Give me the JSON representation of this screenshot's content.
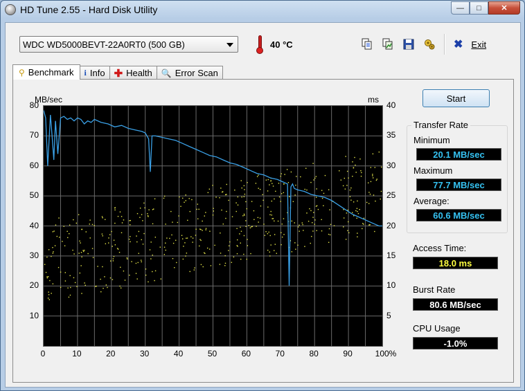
{
  "window": {
    "title": "HD Tune 2.55 - Hard Disk Utility"
  },
  "caption": {
    "minimize": "—",
    "maximize": "□",
    "close": "✕"
  },
  "drive": {
    "selected": "WDC WD5000BEVT-22A0RT0 (500 GB)"
  },
  "temperature": {
    "value": "40 °C"
  },
  "toolbar": {
    "exit_label": "Exit",
    "icons": [
      "copy-text-icon",
      "copy-image-icon",
      "save-icon",
      "options-icon",
      "exit-icon"
    ]
  },
  "tabs": [
    {
      "label": "Benchmark",
      "icon": "benchmark-icon",
      "active": true
    },
    {
      "label": "Info",
      "icon": "info-icon",
      "active": false
    },
    {
      "label": "Health",
      "icon": "health-icon",
      "active": false
    },
    {
      "label": "Error Scan",
      "icon": "error-scan-icon",
      "active": false
    }
  ],
  "actions": {
    "start_label": "Start"
  },
  "transfer_rate": {
    "title": "Transfer Rate",
    "minimum_label": "Minimum",
    "minimum_value": "20.1 MB/sec",
    "maximum_label": "Maximum",
    "maximum_value": "77.7 MB/sec",
    "average_label": "Average:",
    "average_value": "60.6 MB/sec"
  },
  "access_time": {
    "label": "Access Time:",
    "value": "18.0 ms"
  },
  "burst_rate": {
    "label": "Burst Rate",
    "value": "80.6 MB/sec"
  },
  "cpu_usage": {
    "label": "CPU Usage",
    "value": "-1.0%"
  },
  "colors": {
    "transfer_line": "#3aa0e6",
    "access_dots": "#e6e64a",
    "cyan_value": "#35c2f2",
    "yellow_value": "#ffff40",
    "white_value": "#ffffff",
    "grid": "#6a6a6a"
  },
  "chart_data": {
    "type": "line",
    "left_axis_label": "MB/sec",
    "right_axis_label": "ms",
    "ylim_left": [
      0,
      80
    ],
    "ylim_right": [
      0,
      40
    ],
    "xlim": [
      0,
      100
    ],
    "left_ticks": [
      "80",
      "70",
      "60",
      "50",
      "40",
      "30",
      "20",
      "10"
    ],
    "right_ticks": [
      "40",
      "35",
      "30",
      "25",
      "20",
      "15",
      "10",
      "5"
    ],
    "x_ticks": [
      "0",
      "10",
      "20",
      "30",
      "40",
      "50",
      "60",
      "70",
      "80",
      "90",
      "100%"
    ],
    "grid": true,
    "series": [
      {
        "axis": "left",
        "x": [
          0,
          0.6,
          1.2,
          2,
          2.5,
          3,
          3.5,
          4.2,
          5,
          6,
          7,
          8,
          9,
          10,
          11,
          12,
          13,
          14,
          15,
          17,
          19,
          21,
          23,
          25,
          27,
          29,
          30,
          31,
          31.5,
          32,
          33,
          35,
          37,
          39,
          41,
          43,
          45,
          47,
          49,
          51,
          53,
          55,
          57,
          59,
          61,
          63,
          65,
          67,
          69,
          71,
          72,
          72.5,
          73,
          73.5,
          74,
          75,
          77,
          79,
          81,
          83,
          85,
          87,
          89,
          91,
          93,
          95,
          97,
          99,
          100
        ],
        "y": [
          78.5,
          76,
          60,
          77,
          70,
          62,
          75,
          64,
          76,
          76.5,
          75.5,
          76,
          75,
          76,
          75.5,
          74,
          75,
          74.5,
          75.5,
          74.5,
          74,
          73,
          73.5,
          72.5,
          72,
          71.5,
          71,
          69,
          58,
          70,
          70,
          69.5,
          69,
          68.5,
          67.5,
          66.5,
          65.5,
          64.5,
          63.5,
          63,
          62,
          61,
          60.5,
          59.5,
          58.5,
          57.5,
          57,
          56,
          55.5,
          54.5,
          54,
          20.1,
          53,
          54,
          52.5,
          52,
          51.5,
          50.5,
          50,
          49.5,
          48.5,
          47,
          45.5,
          44,
          43,
          42,
          41,
          40,
          40
        ]
      },
      {
        "axis": "right",
        "type": "scatter",
        "description": "access-time samples spread between ~8 ms and ~30 ms, rising with disk position"
      }
    ]
  }
}
